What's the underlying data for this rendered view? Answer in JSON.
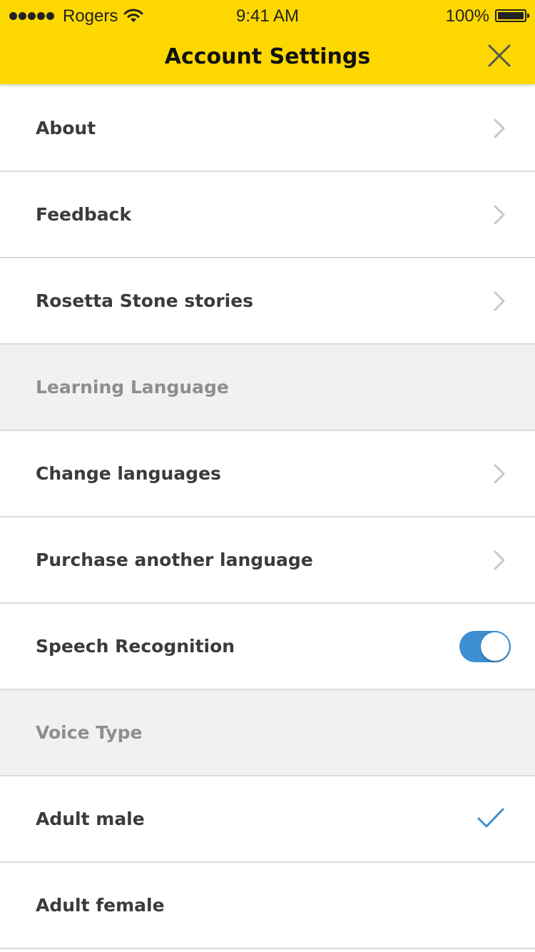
{
  "status_bar": {
    "carrier": "Rogers",
    "time": "9:41 AM",
    "battery": "100%",
    "battery_level": 1.0,
    "signal_bars": 5,
    "icons": [
      "signal-dots-icon",
      "wifi-icon",
      "battery-icon"
    ]
  },
  "header": {
    "title": "Account Settings",
    "close_icon": "close-icon",
    "background_color": "#fdd800"
  },
  "rows": [
    {
      "label": "About",
      "type": "link"
    },
    {
      "label": "Feedback",
      "type": "link"
    },
    {
      "label": "Rosetta Stone stories",
      "type": "link"
    }
  ],
  "learning_section": {
    "header": "Learning Language",
    "rows": [
      {
        "label": "Change languages",
        "type": "link"
      },
      {
        "label": "Purchase another language",
        "type": "link"
      },
      {
        "label": "Speech Recognition",
        "type": "toggle",
        "value": true
      }
    ]
  },
  "voice_section": {
    "header": "Voice Type",
    "rows": [
      {
        "label": "Adult male",
        "selected": true
      },
      {
        "label": "Adult female",
        "selected": false
      }
    ]
  },
  "colors": {
    "accent": "#3d8fd1",
    "section_background": "#f1f1f1",
    "chevron": "#c7c7cc"
  }
}
